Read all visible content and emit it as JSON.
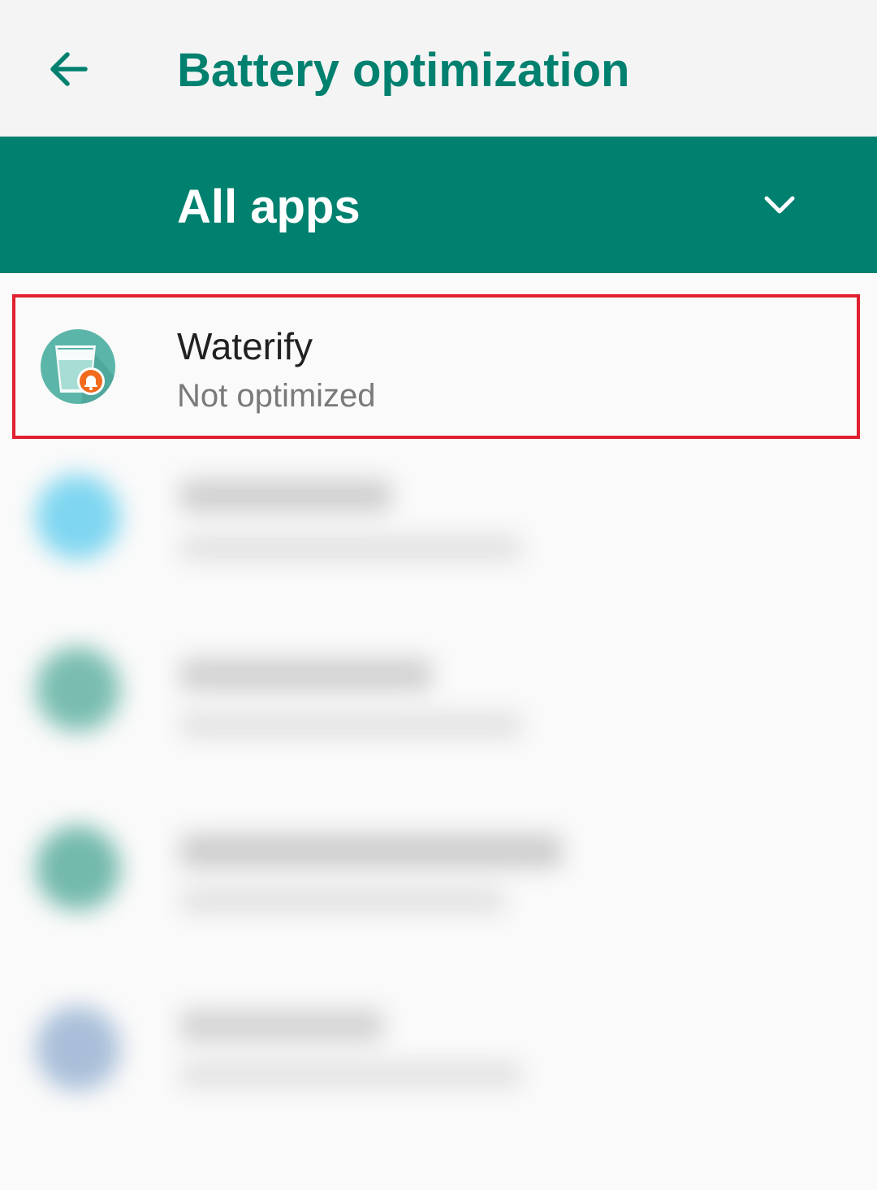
{
  "colors": {
    "accent": "#00806f",
    "app_bar_bg": "#f4f4f4",
    "list_bg": "#fafafa",
    "highlight": "#e0202e",
    "primary_text": "#212121",
    "secondary_text": "#7a7a7a",
    "waterify_icon_bg": "#5bb5a8",
    "waterify_badge": "#f26b1d"
  },
  "header": {
    "back_icon": "arrow-back-icon",
    "title": "Battery optimization"
  },
  "filter": {
    "label": "All apps",
    "icon": "chevron-down-icon"
  },
  "apps": [
    {
      "name": "Waterify",
      "status": "Not optimized",
      "icon": "water-glass-alarm-icon"
    }
  ],
  "blurred_rows": [
    {
      "icon_color": "#7fd6f0"
    },
    {
      "icon_color": "#79bdb0"
    },
    {
      "icon_color": "#73b9ac"
    },
    {
      "icon_color": "#a9bfd9"
    }
  ]
}
